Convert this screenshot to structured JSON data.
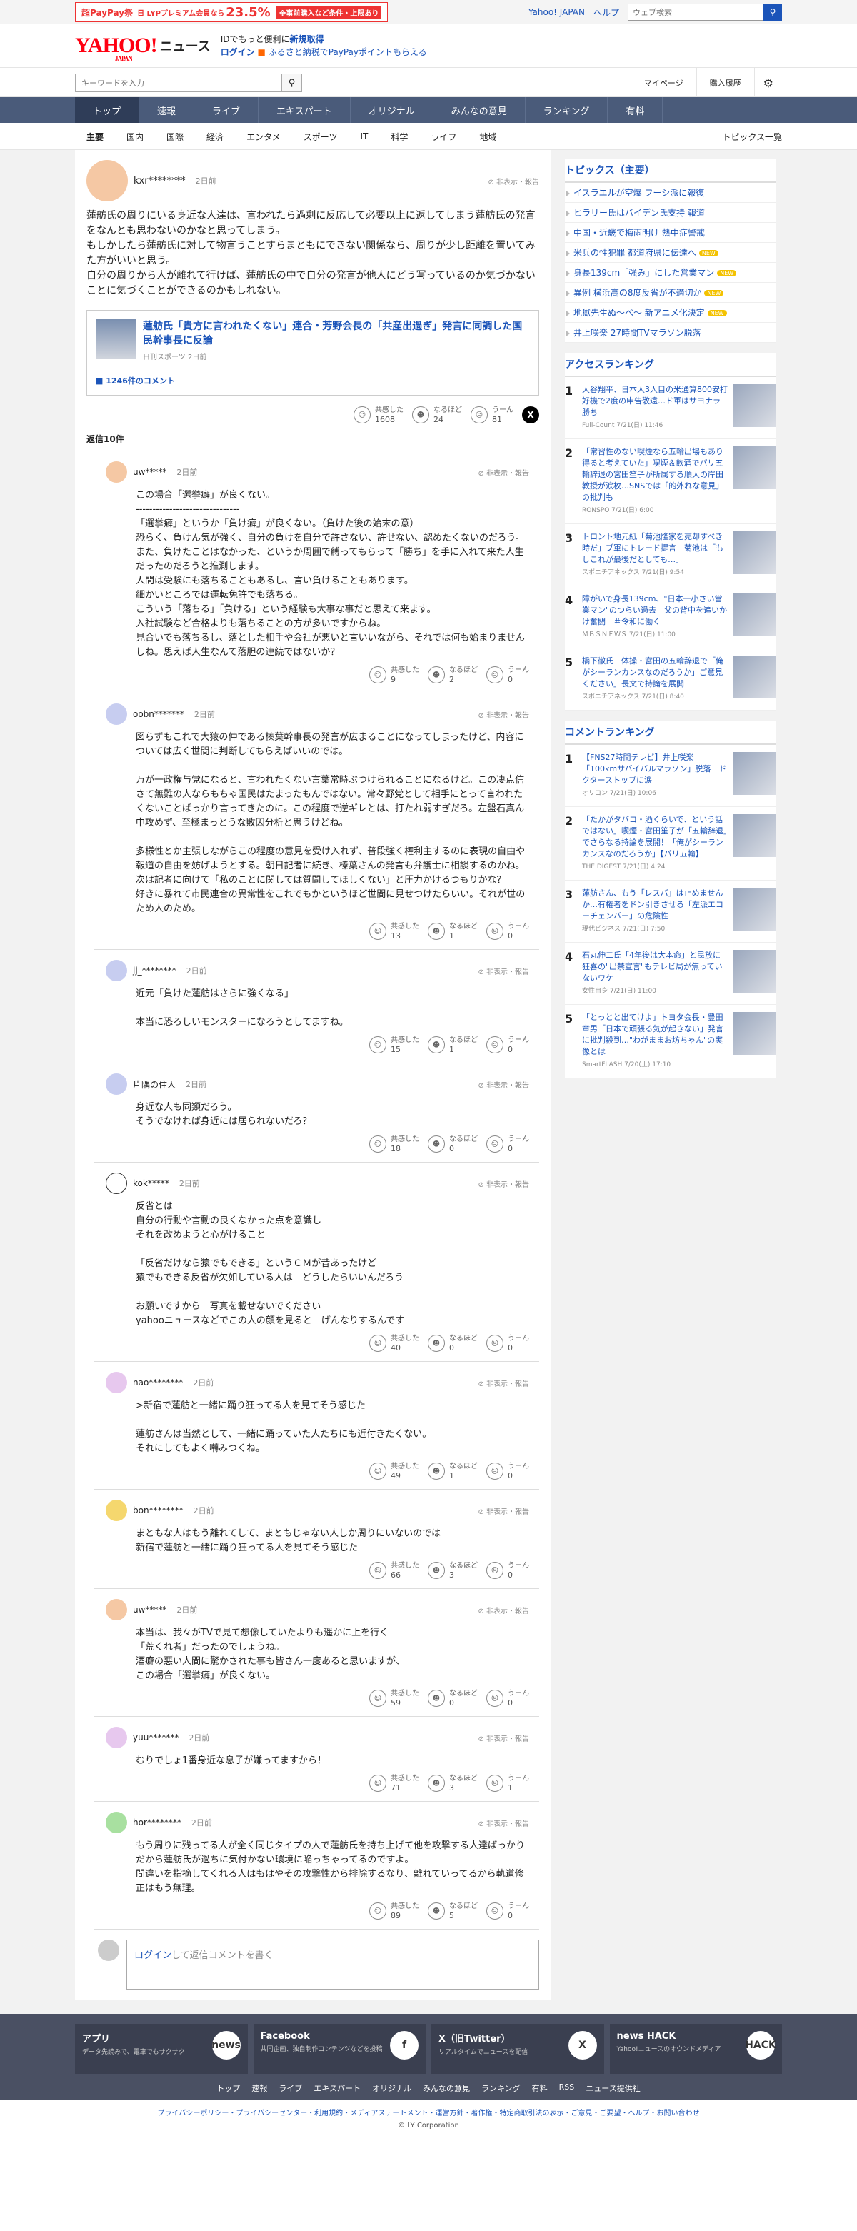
{
  "promo": {
    "prefix": "超PayPay祭",
    "mid": "日 LYPプレミアム会員なら",
    "pct": "23.5%",
    "tail": "※事前購入など条件・上限あり"
  },
  "topbar": {
    "yahoo_japan": "Yahoo! JAPAN",
    "help": "ヘルプ",
    "search_placeholder": "ウェブ検索"
  },
  "header": {
    "logo_main": "YAHOO!",
    "logo_news": "ニュース",
    "logo_sub": "JAPAN",
    "line1_a": "IDでもっと便利に",
    "line1_b": "新規取得",
    "line2_a": "ログイン",
    "line2_b": "ふるさと納税でPayPayポイントもらえる"
  },
  "searchrow": {
    "placeholder": "キーワードを入力",
    "mypage": "マイページ",
    "history": "購入履歴"
  },
  "nav": [
    "トップ",
    "速報",
    "ライブ",
    "エキスパート",
    "オリジナル",
    "みんなの意見",
    "ランキング",
    "有料"
  ],
  "subnav": [
    "主要",
    "国内",
    "国際",
    "経済",
    "エンタメ",
    "スポーツ",
    "IT",
    "科学",
    "ライフ",
    "地域"
  ],
  "subnav_right": "トピックス一覧",
  "main_comment": {
    "user": "kxr********",
    "time": "2日前",
    "report": "非表示・報告",
    "text": "蓮舫氏の周りにいる身近な人達は、言われたら過剰に反応して必要以上に返してしまう蓮舫氏の発言をなんとも思わないのかなと思ってしまう。\nもしかしたら蓮舫氏に対して物言うことすらまともにできない関係なら、周りが少し距離を置いてみた方がいいと思う。\n自分の周りから人が離れて行けば、蓮舫氏の中で自分の発言が他人にどう写っているのか気づかないことに気づくことができるのかもしれない。",
    "article_title": "蓮舫氏「貴方に言われたくない」連合・芳野会長の「共産出過ぎ」発言に同調した国民幹事長に反論",
    "article_meta": "日刊スポーツ 2日前",
    "article_comments": "1246件のコメント",
    "empathy": "1608",
    "naruhodo": "24",
    "uun": "81",
    "reply_count": "返信10件"
  },
  "labels": {
    "empathy": "共感した",
    "naruhodo": "なるほど",
    "uun": "うーん"
  },
  "replies": [
    {
      "user": "uw*****",
      "time": "2日前",
      "color": "#f5c8a4",
      "text": "この場合「選挙癖」が良くない。\n-------------------------------\n「選挙癖」というか「負け癖」が良くない。（負けた後の始末の意）\n恐らく、負けん気が強く、自分の負けを自分で許さない、許せない、認めたくないのだろう。また、負けたことはなかった、というか周囲で縛ってもらって「勝ち」を手に入れて来た人生だったのだろうと推測します。\n人間は受験にも落ちることもあるし、言い負けることもあります。\n細かいところでは運転免許でも落ちる。\nこういう「落ちる」「負ける」という経験も大事な事だと思えて来ます。\n入社試験など合格よりも落ちることの方が多いですからね。\n見合いでも落ちるし、落とした相手や会社が悪いと言いいながら、それでは何も始まりませんしね。思えば人生なんて落胆の連続ではないか？",
      "e": "9",
      "n": "2",
      "u": "0"
    },
    {
      "user": "oobn*******",
      "time": "2日前",
      "color": "#c7cdf0",
      "text": "図らずもこれで大猿の仲である榛葉幹事長の発言が広まることになってしまったけど、内容については広く世間に判断してもらえばいいのでは。\n\n万が一政権与党になると、言われたくない言葉常時ぶつけられることになるけど。この凄点信さて無難の人ならもちゃ国民はたまったもんではない。常々野党として相手にとって言われたくないことばっかり言ってきたのに。この程度で逆ギレとは、打たれ弱すぎだろ。左盤石真ん中攻めず、至極まっとうな敗因分析と思うけどね。\n\n多様性とか主張しながらこの程度の意見を受け入れず、普段強く権利主するのに表現の自由や報道の自由を妨げようとする。朝日記者に続き、榛葉さんの発言も弁護士に相談するのかね。次は記者に向けて「私のことに関しては質問してほしくない」と圧力かけるつもりかな？\n好きに暴れて市民連合の異常性をこれでもかというほど世間に見せつけたらいい。それが世のため人のため。",
      "e": "13",
      "n": "1",
      "u": "0"
    },
    {
      "user": "jj_********",
      "time": "2日前",
      "color": "#c7cdf0",
      "text": "近元「負けた蓮舫はさらに強くなる」\n\n本当に恐ろしいモンスターになろうとしてますね。",
      "e": "15",
      "n": "1",
      "u": "0"
    },
    {
      "user": "片隅の住人",
      "time": "2日前",
      "color": "#c7cdf0",
      "text": "身近な人も同類だろう。\nそうでなければ身近には居られないだろ？",
      "e": "18",
      "n": "0",
      "u": "0"
    },
    {
      "user": "kok*****",
      "time": "2日前",
      "color": "#ffffff",
      "text": "反省とは\n自分の行動や言動の良くなかった点を意識し\nそれを改めようと心がけること\n\n「反省だけなら猿でもできる」というＣＭが昔あったけど\n猿でもできる反省が欠如している人は　どうしたらいいんだろう\n\nお願いですから　写真を載せないでください\nyahooニュースなどでこの人の顔を見ると　げんなりするんです",
      "e": "40",
      "n": "0",
      "u": "0"
    },
    {
      "user": "nao********",
      "time": "2日前",
      "color": "#e7c8ee",
      "text": ">新宿で蓮舫と一緒に踊り狂ってる人を見てそう感じた\n\n蓮舫さんは当然として、一緒に踊っていた人たちにも近付きたくない。\nそれにしてもよく囀みつくね。",
      "e": "49",
      "n": "1",
      "u": "0"
    },
    {
      "user": "bon********",
      "time": "2日前",
      "color": "#f5d76e",
      "text": "まともな人はもう離れてして、まともじゃない人しか周りにいないのでは\n新宿で蓮舫と一緒に踊り狂ってる人を見てそう感じた",
      "e": "66",
      "n": "3",
      "u": "0"
    },
    {
      "user": "uw*****",
      "time": "2日前",
      "color": "#f5c8a4",
      "text": "本当は、我々がTVで見て想像していたよりも遥かに上を行く\n「荒くれ者」だったのでしょうね。\n酒癖の悪い人間に驚かされた事も皆さん一度あると思いますが、\nこの場合「選挙癖」が良くない。",
      "e": "59",
      "n": "0",
      "u": "0"
    },
    {
      "user": "yuu*******",
      "time": "2日前",
      "color": "#e7c8ee",
      "text": "むりでしょ1番身近な息子が嫌ってますから！",
      "e": "71",
      "n": "3",
      "u": "1"
    },
    {
      "user": "hor********",
      "time": "2日前",
      "color": "#a8e0a0",
      "text": "もう周りに残ってる人が全く同じタイプの人で蓮舫氏を持ち上げて他を攻撃する人達ばっかりだから蓮舫氏が過ちに気付かない環境に陥っちゃってるのですよ。\n間違いを指摘してくれる人はもはやその攻撃性から排除するなり、離れていってるから軌道修正はもう無理。",
      "e": "89",
      "n": "5",
      "u": "0"
    }
  ],
  "composer": {
    "login": "ログイン",
    "rest": "して返信コメントを書く"
  },
  "side": {
    "topics_title": "トピックス（主要）",
    "topics": [
      {
        "t": "イスラエルが空爆 フーシ派に報復",
        "new": false
      },
      {
        "t": "ヒラリー氏はバイデン氏支持 報道",
        "new": false
      },
      {
        "t": "中国・近畿で梅雨明け 熱中症警戒",
        "new": false
      },
      {
        "t": "米兵の性犯罪 都道府県に伝達へ",
        "new": true
      },
      {
        "t": "身長139cm「強み」にした営業マン",
        "new": true
      },
      {
        "t": "異例 横浜高の8度反省が不適切か",
        "new": true
      },
      {
        "t": "地獄先生ぬ〜べ〜 新アニメ化決定",
        "new": true
      },
      {
        "t": "井上咲楽 27時間TVマラソン脱落",
        "new": false
      }
    ],
    "access_title": "アクセスランキング",
    "access": [
      {
        "n": "1",
        "t": "大谷翔平、日本人3人目の米通算800安打　好機で2度の申告敬遠…ド軍はサヨナラ勝ち",
        "s": "Full-Count 7/21(日) 11:46"
      },
      {
        "n": "2",
        "t": "「常習性のない喫煙なら五輪出場もあり得ると考えていた」喫煙＆飲酒でパリ五輪辞退の宮田笙子が所属する順大の岸田教授が涙枚…SNSでは「的外れな意見」の批判も",
        "s": "RONSPO 7/21(日) 6:00"
      },
      {
        "n": "3",
        "t": "トロント地元紙「菊池隆家を売却すべき時だ」ブ軍にトレード提言　菊池は「もしこれが最後だとしても…」",
        "s": "スポニチアネックス 7/21(日) 9:54"
      },
      {
        "n": "4",
        "t": "障がいで身長139cm、\"日本一小さい営業マン\"のつらい過去　父の背中を追いかけ奮闘　＃令和に働く",
        "s": "ＭＢＳＮＥＷＳ 7/21(日) 11:00"
      },
      {
        "n": "5",
        "t": "橋下徹氏　体操・宮田の五輪辞退で「俺がシーランカンスなのだろうか」ご意見ください」長文で持論を展開",
        "s": "スポニチアネックス 7/21(日) 8:40"
      }
    ],
    "comment_title": "コメントランキング",
    "comment": [
      {
        "n": "1",
        "t": "【FNS27時間テレビ】井上咲楽「100kmサバイバルマラソン」脱落　ドクターストップに涙",
        "s": "オリコン 7/21(日) 10:06"
      },
      {
        "n": "2",
        "t": "「たかがタバコ・酒くらいで、という話ではない」喫煙・宮田笙子が「五輪辞退」でさらなる持論を展開！「俺がシーランカンスなのだろうか」【パリ五輪】",
        "s": "THE DIGEST 7/21(日) 4:24"
      },
      {
        "n": "3",
        "t": "蓮舫さん、もう「レスバ」は止めませんか…有権者をドン引きさせる「左派エコーチェンバー」の危険性",
        "s": "現代ビジネス 7/21(日) 7:50"
      },
      {
        "n": "4",
        "t": "石丸伸二氏「4年後は大本命」と民放に狂喜の\"出禁宣言\"もテレビ局が焦っていないワケ",
        "s": "女性自身 7/21(日) 11:00"
      },
      {
        "n": "5",
        "t": "「とっとと出てけよ」トヨタ会長・豊田章男「日本で頑張る気が起きない」発言に批判殺到…\"わがままお坊ちゃん\"の実像とは",
        "s": "SmartFLASH 7/20(土) 17:10"
      }
    ]
  },
  "footer": {
    "cards": [
      {
        "t": "アプリ",
        "d": "データ先読みで、電車でもサクサク",
        "ic": "news"
      },
      {
        "t": "Facebook",
        "d": "共同企画、独自制作コンテンツなどを投稿",
        "ic": "f"
      },
      {
        "t": "X（旧Twitter）",
        "d": "リアルタイムでニュースを配信",
        "ic": "X"
      },
      {
        "t": "news HACK",
        "d": "Yahoo!ニュースのオウンドメディア",
        "ic": "HACK"
      }
    ],
    "links": [
      "トップ",
      "速報",
      "ライブ",
      "エキスパート",
      "オリジナル",
      "みんなの意見",
      "ランキング",
      "有料",
      "RSS",
      "ニュース提供社"
    ],
    "bottom": "プライバシーポリシー・プライバシーセンター・利用規約・メディアステートメント・運営方針・著作権・特定商取引法の表示・ご意見・ご要望・ヘルプ・お問い合わせ",
    "copyright": "© LY Corporation"
  }
}
